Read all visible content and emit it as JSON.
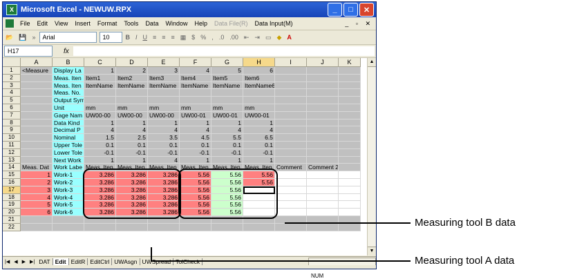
{
  "window": {
    "title": "Microsoft Excel - NEWUW.RPX"
  },
  "menu": [
    "File",
    "Edit",
    "View",
    "Insert",
    "Format",
    "Tools",
    "Data",
    "Window",
    "Help"
  ],
  "menu_disabled": "Data File(R)",
  "menu_extra": "Data Input(M)",
  "toolbar": {
    "font": "Arial",
    "size": "10"
  },
  "formula_bar": {
    "name_box": "H17",
    "fx": "fx"
  },
  "columns": [
    "A",
    "B",
    "C",
    "D",
    "E",
    "F",
    "G",
    "H",
    "I",
    "J",
    "K"
  ],
  "rows": [
    {
      "n": "1",
      "A": "<Measure",
      "B": "Display La",
      "C": "1",
      "D": "2",
      "E": "3",
      "F": "4",
      "G": "5",
      "H": "6"
    },
    {
      "n": "2",
      "B": "Meas. Iten",
      "C": "Item1",
      "D": "Item2",
      "E": "Item3",
      "F": "Item4",
      "G": "Item5",
      "H": "Item6"
    },
    {
      "n": "3",
      "B": "Meas. Iten",
      "C": "ItemName",
      "D": "ItemName",
      "E": "ItemName",
      "F": "ItemName",
      "G": "ItemName",
      "H": "ItemName6"
    },
    {
      "n": "4",
      "B": "Meas. No."
    },
    {
      "n": "5",
      "B": "Output Symbol"
    },
    {
      "n": "6",
      "B": "Unit",
      "C": "mm",
      "D": "mm",
      "E": "mm",
      "F": "mm",
      "G": "mm",
      "H": "mm"
    },
    {
      "n": "7",
      "B": "Gage Nam",
      "C": "UW00-00",
      "D": "UW00-00",
      "E": "UW00-00",
      "F": "UW00-01",
      "G": "UW00-01",
      "H": "UW00-01"
    },
    {
      "n": "8",
      "B": "Data Kind",
      "C": "1",
      "D": "1",
      "E": "1",
      "F": "1",
      "G": "1",
      "H": "1"
    },
    {
      "n": "9",
      "B": "Decimal P",
      "C": "4",
      "D": "4",
      "E": "4",
      "F": "4",
      "G": "4",
      "H": "4"
    },
    {
      "n": "10",
      "B": "Nominal",
      "C": "1.5",
      "D": "2.5",
      "E": "3.5",
      "F": "4.5",
      "G": "5.5",
      "H": "6.5"
    },
    {
      "n": "11",
      "B": "Upper Tole",
      "C": "0.1",
      "D": "0.1",
      "E": "0.1",
      "F": "0.1",
      "G": "0.1",
      "H": "0.1"
    },
    {
      "n": "12",
      "B": "Lower Tole",
      "C": "-0.1",
      "D": "-0.1",
      "E": "-0.1",
      "F": "-0.1",
      "G": "-0.1",
      "H": "-0.1"
    },
    {
      "n": "13",
      "B": "Next Work",
      "C": "1",
      "D": "1",
      "E": "4",
      "F": "1",
      "G": "1",
      "H": "1"
    },
    {
      "n": "14",
      "A": "Meas. Dat",
      "B": "Work Labe",
      "C": "Meas. Iten",
      "D": "Meas. Iten",
      "E": "Meas. Iten",
      "F": "Meas. Iten",
      "G": "Meas. Iten",
      "H": "Meas. Iten",
      "I": "Comment",
      "J": "Comment 2"
    },
    {
      "n": "15",
      "A": "1",
      "B": "Work-1",
      "C": "3.286",
      "D": "3.286",
      "E": "3.286",
      "F": "5.56",
      "G": "5.56",
      "H": "5.56"
    },
    {
      "n": "16",
      "A": "2",
      "B": "Work-2",
      "C": "3.286",
      "D": "3.286",
      "E": "3.286",
      "F": "5.56",
      "G": "5.56",
      "H": "5.56"
    },
    {
      "n": "17",
      "A": "3",
      "B": "Work-3",
      "C": "3.286",
      "D": "3.286",
      "E": "3.286",
      "F": "5.56",
      "G": "5.56"
    },
    {
      "n": "18",
      "A": "4",
      "B": "Work-4",
      "C": "3.286",
      "D": "3.286",
      "E": "3.286",
      "F": "5.56",
      "G": "5.56"
    },
    {
      "n": "19",
      "A": "5",
      "B": "Work-5",
      "C": "3.286",
      "D": "3.286",
      "E": "3.286",
      "F": "5.56",
      "G": "5.56"
    },
    {
      "n": "20",
      "A": "6",
      "B": "Work-6",
      "C": "3.286",
      "D": "3.286",
      "E": "3.286",
      "F": "5.56",
      "G": "5.56"
    },
    {
      "n": "21"
    },
    {
      "n": "22"
    }
  ],
  "tabs": [
    "DAT",
    "Edit",
    "EditR",
    "EditCtrl",
    "UWAsgn",
    "UWSpread",
    "TolCheck"
  ],
  "active_tab": "Edit",
  "status": {
    "num": "NUM"
  },
  "callouts": {
    "b": "Measuring tool B data",
    "a": "Measuring tool A data"
  },
  "colors": {
    "header_gray": "#c0c0c0",
    "cyan": "#99ffff",
    "red": "#ff8080",
    "green": "#ccffcc",
    "title": "#1744b8"
  }
}
